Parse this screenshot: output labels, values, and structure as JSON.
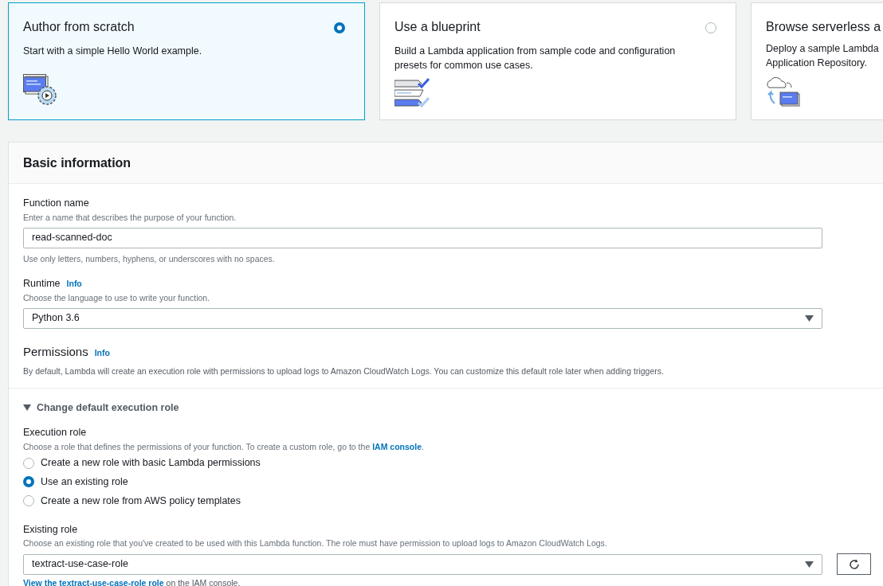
{
  "cards": [
    {
      "title": "Author from scratch",
      "description": [
        "Start with a simple Hello World example."
      ],
      "selected": true,
      "radio_shown": true,
      "kind": "scratch"
    },
    {
      "title": "Use a blueprint",
      "description": [
        "Build a Lambda application from sample code and configuration",
        "presets for common use cases."
      ],
      "selected": false,
      "radio_shown": true,
      "kind": "blueprint"
    },
    {
      "title": "Browse serverless a",
      "description": [
        "Deploy a sample Lambda",
        "Application Repository."
      ],
      "selected": false,
      "radio_shown": false,
      "kind": "serverless"
    }
  ],
  "panel": {
    "title": "Basic information",
    "function_name": {
      "label": "Function name",
      "hint": "Enter a name that describes the purpose of your function.",
      "value": "read-scanned-doc",
      "note": "Use only letters, numbers, hyphens, or underscores with no spaces."
    },
    "runtime": {
      "label": "Runtime",
      "info": "Info",
      "hint": "Choose the language to use to write your function.",
      "value": "Python 3.6"
    },
    "permissions": {
      "title": "Permissions",
      "info": "Info",
      "text": "By default, Lambda will create an execution role with permissions to upload logs to Amazon CloudWatch Logs. You can customize this default role later when adding triggers."
    },
    "expander": {
      "label": "Change default execution role",
      "expanded": true
    },
    "execution_role": {
      "label": "Execution role",
      "hint": "Choose a role that defines the permissions of your function. To create a custom role, go to the",
      "hint_link": "IAM console",
      "hint_end": ".",
      "options": [
        {
          "label": "Create a new role with basic Lambda permissions",
          "selected": false
        },
        {
          "label": "Use an existing role",
          "selected": true
        },
        {
          "label": "Create a new role from AWS policy templates",
          "selected": false
        }
      ]
    },
    "existing_role": {
      "label": "Existing role",
      "hint": "Choose an existing role that you've created to be used with this Lambda function. The role must have permission to upload logs to Amazon CloudWatch Logs.",
      "value": "textract-use-case-role",
      "link": "View the textract-use-case-role role",
      "link_tail": "on the IAM console."
    }
  }
}
